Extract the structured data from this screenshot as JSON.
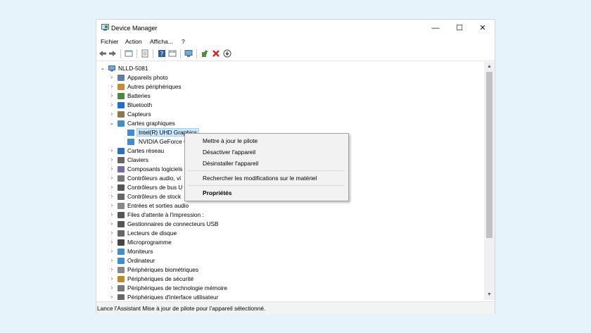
{
  "window": {
    "title": "Device Manager",
    "controls": {
      "minimize": "—",
      "maximize": "☐",
      "close": "✕"
    }
  },
  "menubar": [
    "Fichier",
    "Action",
    "Afficha...",
    "?"
  ],
  "toolbar": [
    "back-icon",
    "forward-icon",
    "properties-icon",
    "view-icon",
    "help-icon",
    "view-list-icon",
    "monitor-scan-icon",
    "update-driver-icon",
    "uninstall-icon",
    "download-icon"
  ],
  "tree": {
    "root": "NLLD-5081",
    "categories": [
      {
        "label": "Appareils photo",
        "icon": "camera-icon"
      },
      {
        "label": "Autres périphériques",
        "icon": "unknown-device-icon"
      },
      {
        "label": "Batteries",
        "icon": "battery-icon"
      },
      {
        "label": "Bluetooth",
        "icon": "bluetooth-icon"
      },
      {
        "label": "Capteurs",
        "icon": "sensor-icon"
      },
      {
        "label": "Cartes graphiques",
        "icon": "display-adapter-icon",
        "expanded": true,
        "children": [
          "Intel(R) UHD Graphics",
          "NVIDIA GeForce G"
        ]
      },
      {
        "label": "Cartes réseau",
        "icon": "network-icon"
      },
      {
        "label": "Claviers",
        "icon": "keyboard-icon"
      },
      {
        "label": "Composants logiciels",
        "icon": "software-component-icon"
      },
      {
        "label": "Contrôleurs audio, vi",
        "icon": "audio-icon"
      },
      {
        "label": "Contrôleurs de bus U",
        "icon": "usb-icon"
      },
      {
        "label": "Contrôleurs de stock",
        "icon": "storage-controller-icon"
      },
      {
        "label": "Entrées et sorties audio",
        "icon": "speaker-icon"
      },
      {
        "label": "Files d'attente à l'impression :",
        "icon": "printer-icon"
      },
      {
        "label": "Gestionnaires de connecteurs USB",
        "icon": "usb-connector-icon"
      },
      {
        "label": "Lecteurs de disque",
        "icon": "disk-drive-icon"
      },
      {
        "label": "Microprogramme",
        "icon": "firmware-icon"
      },
      {
        "label": "Moniteurs",
        "icon": "monitor-icon"
      },
      {
        "label": "Ordinateur",
        "icon": "computer-icon"
      },
      {
        "label": "Périphériques biométriques",
        "icon": "fingerprint-icon"
      },
      {
        "label": "Périphériques de sécurité",
        "icon": "security-icon"
      },
      {
        "label": "Périphériques de technologie mémoire",
        "icon": "memory-icon"
      },
      {
        "label": "Périphériques d'interface utilisateur",
        "icon": "hid-icon"
      }
    ]
  },
  "context_menu": {
    "items": [
      {
        "label": "Mettre à jour le pilote"
      },
      {
        "label": "Désactiver l'appareil"
      },
      {
        "label": "Désinstaller l'appareil"
      },
      {
        "label": "Rechercher les modifications sur le matériel"
      },
      {
        "label": "Propriétés",
        "bold": true
      }
    ]
  },
  "statusbar": {
    "text": "Lance l'Assistant Mise à jour de pilote pour l'appareil sélectionné."
  }
}
